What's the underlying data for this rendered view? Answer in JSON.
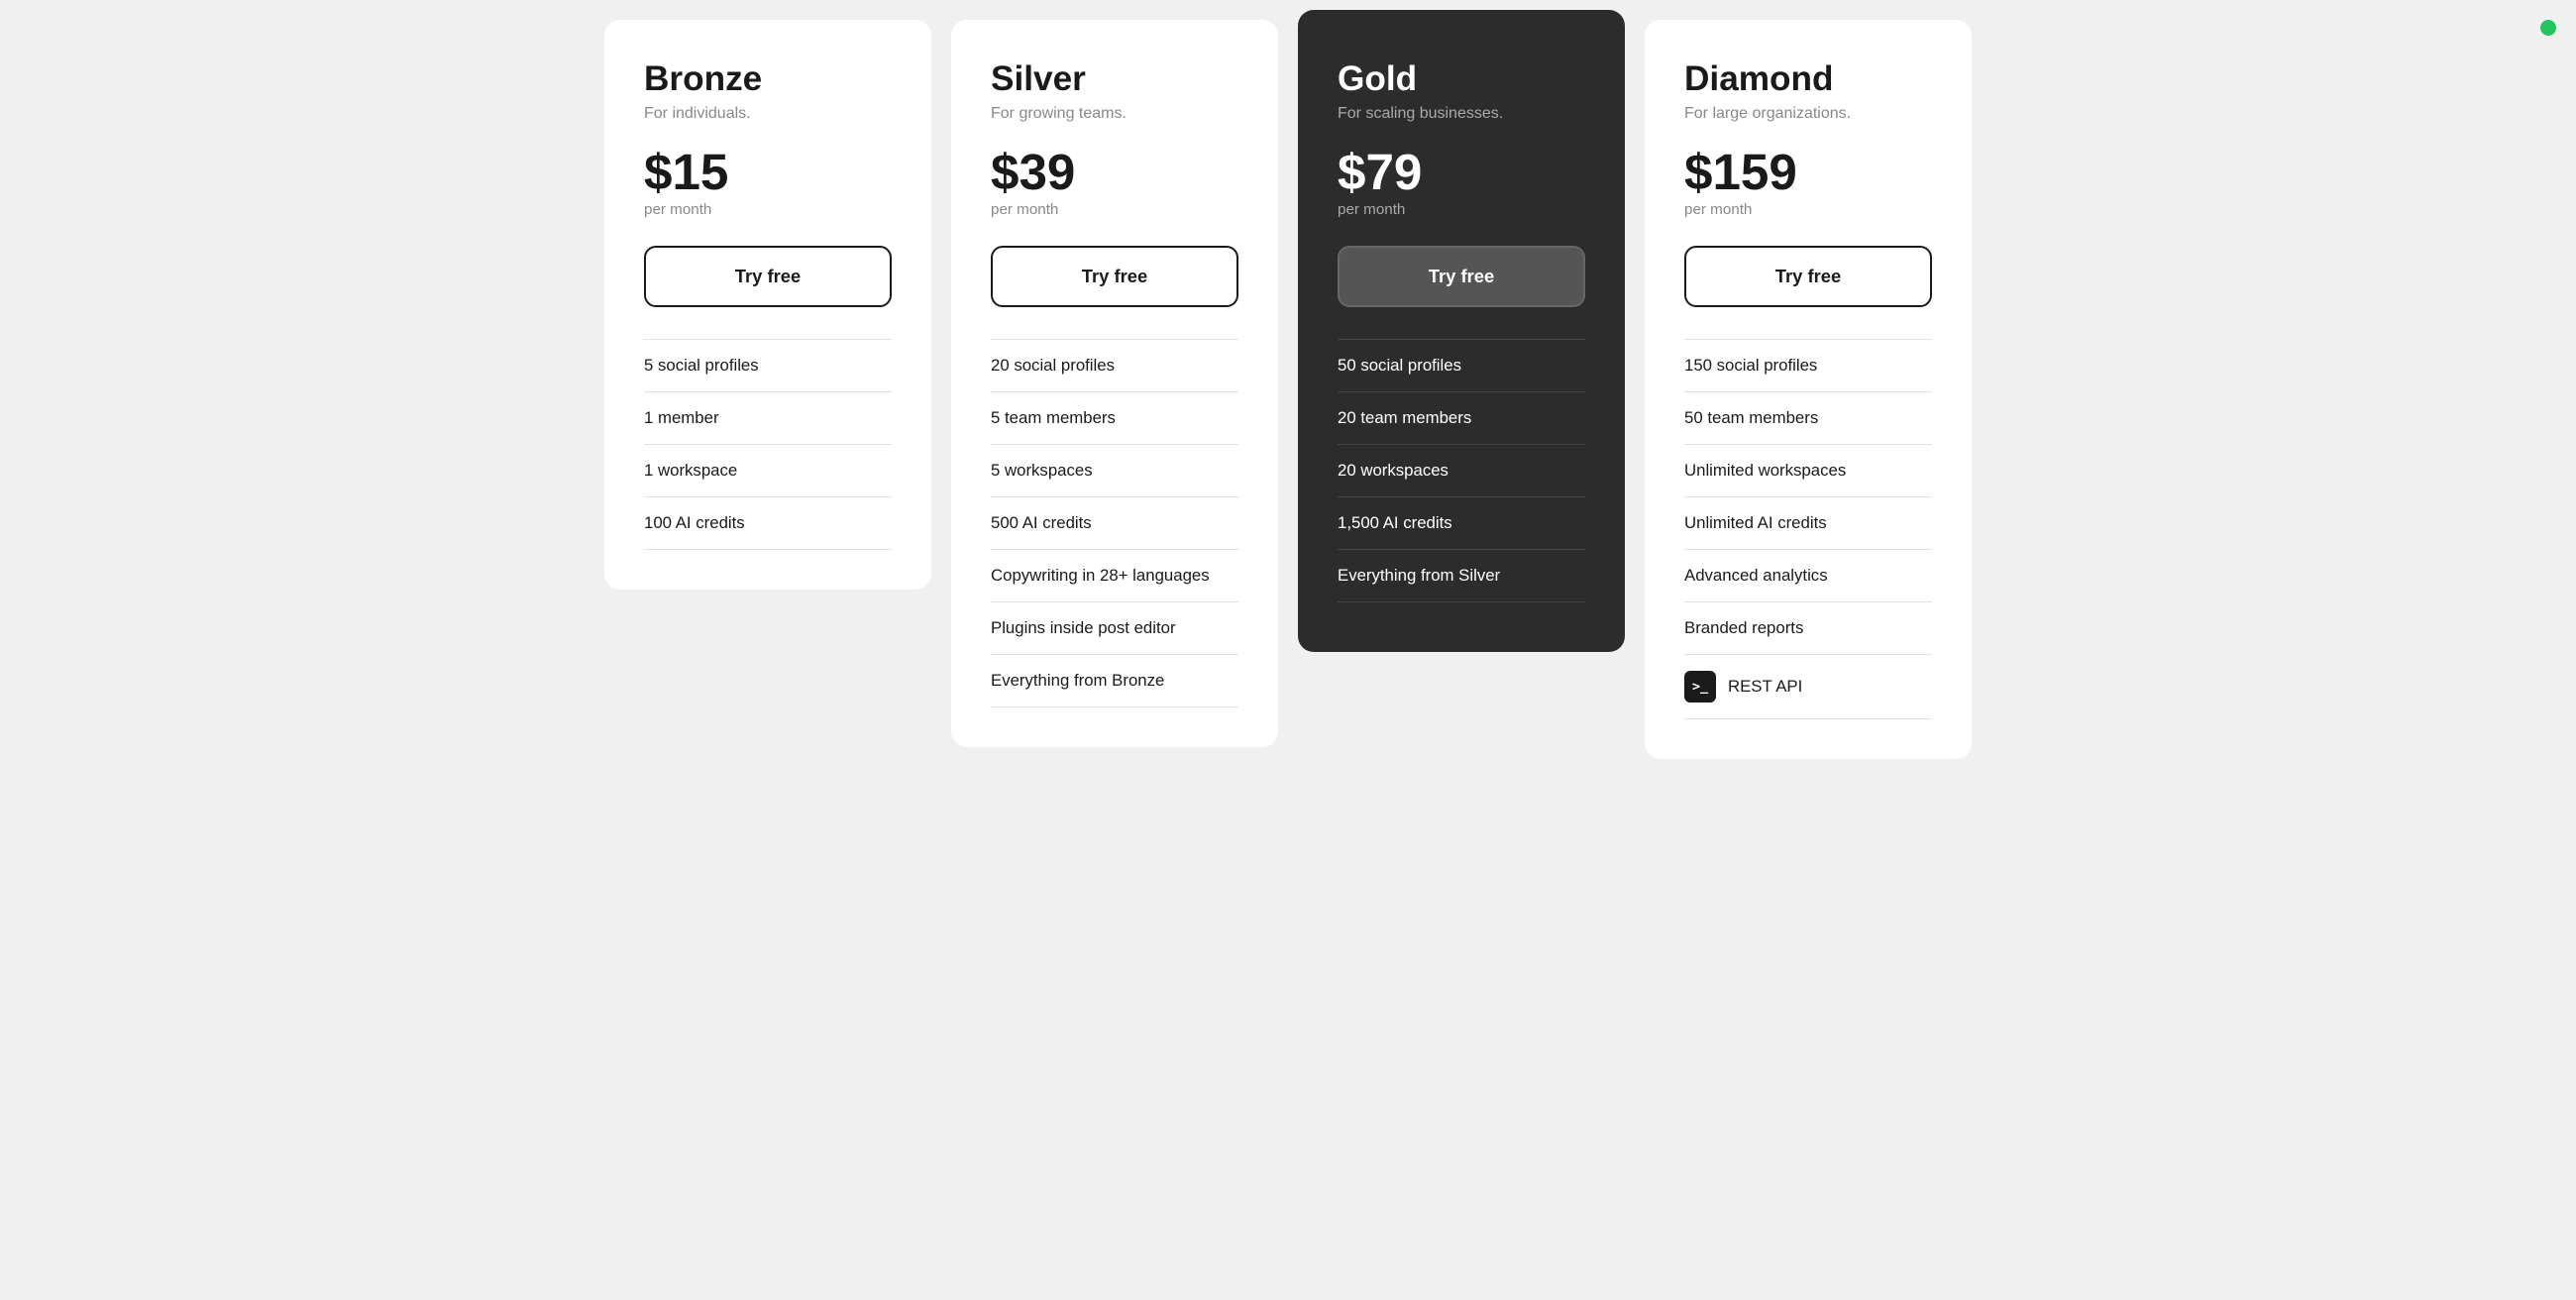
{
  "plans": [
    {
      "id": "bronze",
      "name": "Bronze",
      "tagline": "For individuals.",
      "price": "$15",
      "period": "per month",
      "cta": "Try free",
      "theme": "light",
      "features": [
        "5 social profiles",
        "1 member",
        "1 workspace",
        "100 AI credits"
      ]
    },
    {
      "id": "silver",
      "name": "Silver",
      "tagline": "For growing teams.",
      "price": "$39",
      "period": "per month",
      "cta": "Try free",
      "theme": "light",
      "features": [
        "20 social profiles",
        "5 team members",
        "5 workspaces",
        "500 AI credits",
        "Copywriting in 28+ languages",
        "Plugins inside post editor",
        "Everything from Bronze"
      ]
    },
    {
      "id": "gold",
      "name": "Gold",
      "tagline": "For scaling businesses.",
      "price": "$79",
      "period": "per month",
      "cta": "Try free",
      "theme": "dark",
      "features": [
        "50 social profiles",
        "20 team members",
        "20 workspaces",
        "1,500 AI credits",
        "Everything from Silver"
      ]
    },
    {
      "id": "diamond",
      "name": "Diamond",
      "tagline": "For large organizations.",
      "price": "$159",
      "period": "per month",
      "cta": "Try free",
      "theme": "light",
      "features": [
        "150 social profiles",
        "50 team members",
        "Unlimited workspaces",
        "Unlimited AI credits",
        "Advanced analytics",
        "Branded reports",
        "REST API"
      ],
      "feature_icons": {
        "REST API": "terminal"
      }
    }
  ],
  "labels": {
    "per_month": "per month",
    "try_free": "Try free",
    "terminal_icon": ">_"
  }
}
